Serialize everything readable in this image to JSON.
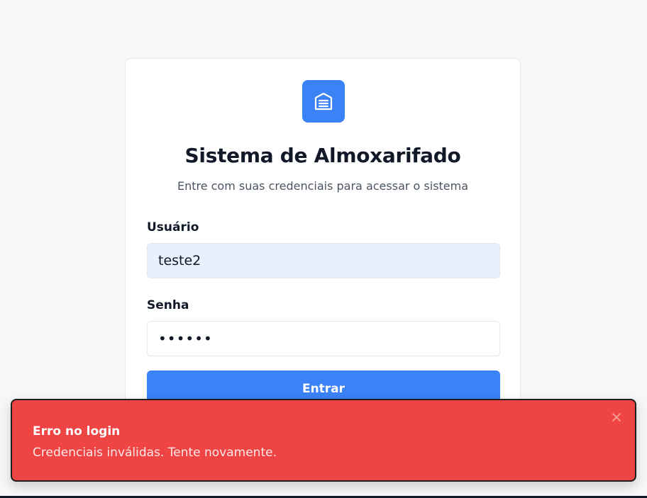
{
  "login": {
    "logo_icon": "warehouse-icon",
    "title": "Sistema de Almoxarifado",
    "subtitle": "Entre com suas credenciais para acessar o sistema",
    "username_label": "Usuário",
    "username_value": "teste2",
    "password_label": "Senha",
    "password_value": "••••••",
    "submit_label": "Entrar"
  },
  "toast": {
    "title": "Erro no login",
    "message": "Credenciais inválidas. Tente novamente.",
    "close_icon": "close-icon"
  },
  "colors": {
    "primary": "#3b82f6",
    "error": "#ef4444",
    "background": "#f7f7f8",
    "autofill": "#e8f0fe"
  }
}
